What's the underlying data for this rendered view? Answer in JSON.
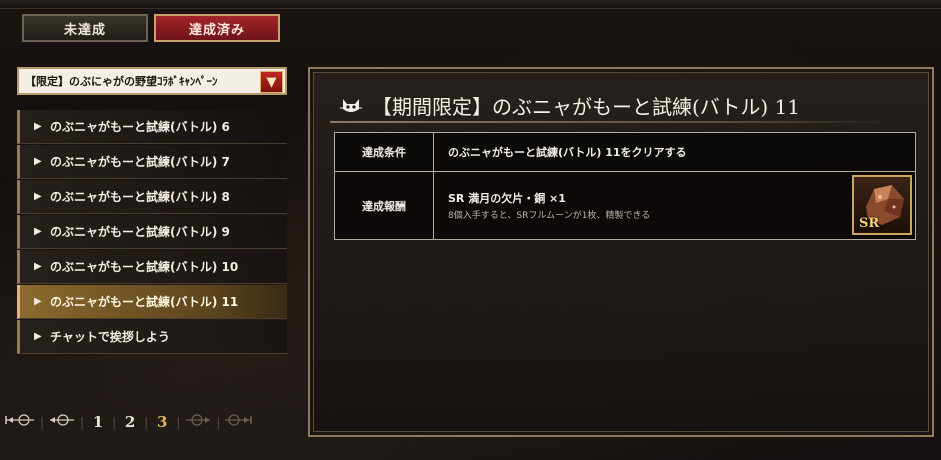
{
  "tabs": {
    "incomplete": "未達成",
    "completed": "達成済み"
  },
  "campaign_select": {
    "value": "【限定】のぶにゃがの野望ｺﾗﾎﾞｷｬﾝﾍﾟｰﾝ",
    "arrow_icon": "chevron-down-icon"
  },
  "missions": [
    {
      "label": "のぶニャがもーと試練(バトル) 6",
      "selected": false
    },
    {
      "label": "のぶニャがもーと試練(バトル) 7",
      "selected": false
    },
    {
      "label": "のぶニャがもーと試練(バトル) 8",
      "selected": false
    },
    {
      "label": "のぶニャがもーと試練(バトル) 9",
      "selected": false
    },
    {
      "label": "のぶニャがもーと試練(バトル) 10",
      "selected": false
    },
    {
      "label": "のぶニャがもーと試練(バトル) 11",
      "selected": true
    },
    {
      "label": "チャットで挨拶しよう",
      "selected": false
    }
  ],
  "pagination": {
    "pages": [
      "1",
      "2",
      "3"
    ],
    "current": "3"
  },
  "detail": {
    "title": "【期間限定】のぶニャがもーと試練(バトル) 11",
    "condition_header": "達成条件",
    "condition_text": "のぶニャがもーと試練(バトル) 11をクリアする",
    "reward_header": "達成報酬",
    "reward_name": "SR 満月の欠片・銅 ×1",
    "reward_note": "8個入手すると、SRフルムーンが1枚、精製できる",
    "reward_rarity": "SR"
  },
  "colors": {
    "active_tab": "#a4252a",
    "selected_item": "#8b6a2e",
    "current_page": "#e0b54a"
  }
}
